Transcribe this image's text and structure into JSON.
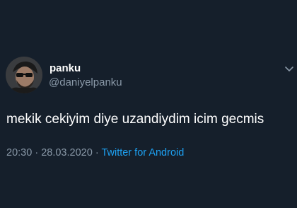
{
  "user": {
    "display_name": "panku",
    "handle": "@daniyelpanku"
  },
  "tweet": {
    "text": "mekik cekiyim diye uzandiydim icim gecmis",
    "time": "20:30",
    "separator": "·",
    "date": "28.03.2020",
    "source": "Twitter for Android"
  },
  "icons": {
    "avatar": "profile-photo",
    "menu": "chevron-down-icon"
  },
  "colors": {
    "background": "#151f2b",
    "primary_text": "#ffffff",
    "secondary_text": "#8a99a8",
    "link": "#1da1f2"
  }
}
